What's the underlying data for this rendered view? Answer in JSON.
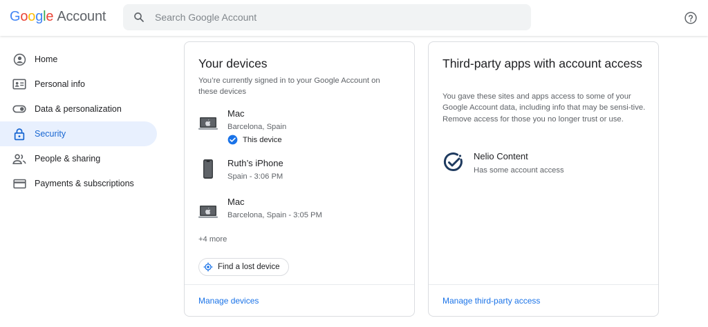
{
  "header": {
    "logo_letters": [
      "G",
      "o",
      "o",
      "g",
      "l",
      "e"
    ],
    "logo_suffix": "Account",
    "search_placeholder": "Search Google Account",
    "help_icon": "help-circle-icon"
  },
  "sidebar": {
    "items": [
      {
        "label": "Home",
        "icon": "account-circle-icon",
        "active": false
      },
      {
        "label": "Personal info",
        "icon": "id-card-icon",
        "active": false
      },
      {
        "label": "Data & personalization",
        "icon": "toggle-icon",
        "active": false
      },
      {
        "label": "Security",
        "icon": "lock-icon",
        "active": true
      },
      {
        "label": "People & sharing",
        "icon": "people-icon",
        "active": false
      },
      {
        "label": "Payments & subscriptions",
        "icon": "credit-card-icon",
        "active": false
      }
    ]
  },
  "devices_card": {
    "title": "Your devices",
    "description": "You’re currently signed in to your Google Account on these devices",
    "devices": [
      {
        "name": "Mac",
        "subtitle": "Barcelona, Spain",
        "status": "This device",
        "icon": "laptop-icon"
      },
      {
        "name": "Ruth’s iPhone",
        "subtitle": "Spain - 3:06 PM",
        "icon": "phone-icon"
      },
      {
        "name": "Mac",
        "subtitle": "Barcelona, Spain - 3:05 PM",
        "icon": "laptop-icon"
      }
    ],
    "more": "+4 more",
    "find_button": "Find a lost device",
    "footer_link": "Manage devices"
  },
  "apps_card": {
    "title": "Third-party apps with account access",
    "description": "You gave these sites and apps access to some of your Google Account data, including info that may be sensi-tive. Remove access for those you no longer trust or use.",
    "apps": [
      {
        "name": "Nelio Content",
        "subtitle": "Has some account access",
        "icon": "nelio-content-logo-icon"
      }
    ],
    "footer_link": "Manage third-party access"
  },
  "colors": {
    "accent": "#1a73e8",
    "active_bg": "#e8f0fe",
    "active_text": "#1967d2"
  }
}
